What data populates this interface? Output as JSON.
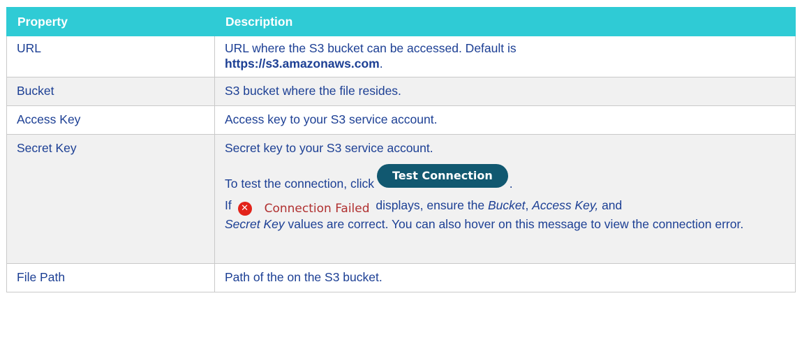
{
  "table": {
    "headers": [
      "Property",
      "Description"
    ],
    "rows": {
      "url": {
        "property": "URL",
        "desc_pre": "URL where the S3 bucket can be accessed. Default is",
        "desc_link": "https://s3.amazonaws.com",
        "desc_post": "."
      },
      "bucket": {
        "property": "Bucket",
        "desc": "S3 bucket where the file resides."
      },
      "access_key": {
        "property": "Access Key",
        "desc": "Access key to your S3 service account."
      },
      "secret_key": {
        "property": "Secret Key",
        "desc": "Secret key to your S3 service account.",
        "test_pre": "To test the connection, click",
        "test_button": "Test Connection",
        "test_post": ".",
        "fail_if": "If",
        "fail_badge": "Connection Failed",
        "fail_displays": "displays, ensure the",
        "fail_bucket": "Bucket",
        "fail_sep1": ",",
        "fail_access": "Access Key,",
        "fail_and": "and",
        "fail_secret": "Secret Key",
        "fail_rest": "values are correct. You can also hover on this message to view the connection error."
      },
      "file_path": {
        "property": "File Path",
        "desc": "Path of the on the S3 bucket."
      }
    }
  },
  "colors": {
    "header_bg": "#2fcbd5",
    "text": "#1c3f94",
    "alt_row": "#f1f1f1",
    "button_bg": "#115870",
    "error_icon": "#e2231a"
  },
  "icons": {
    "fail": "close-circle-icon"
  }
}
